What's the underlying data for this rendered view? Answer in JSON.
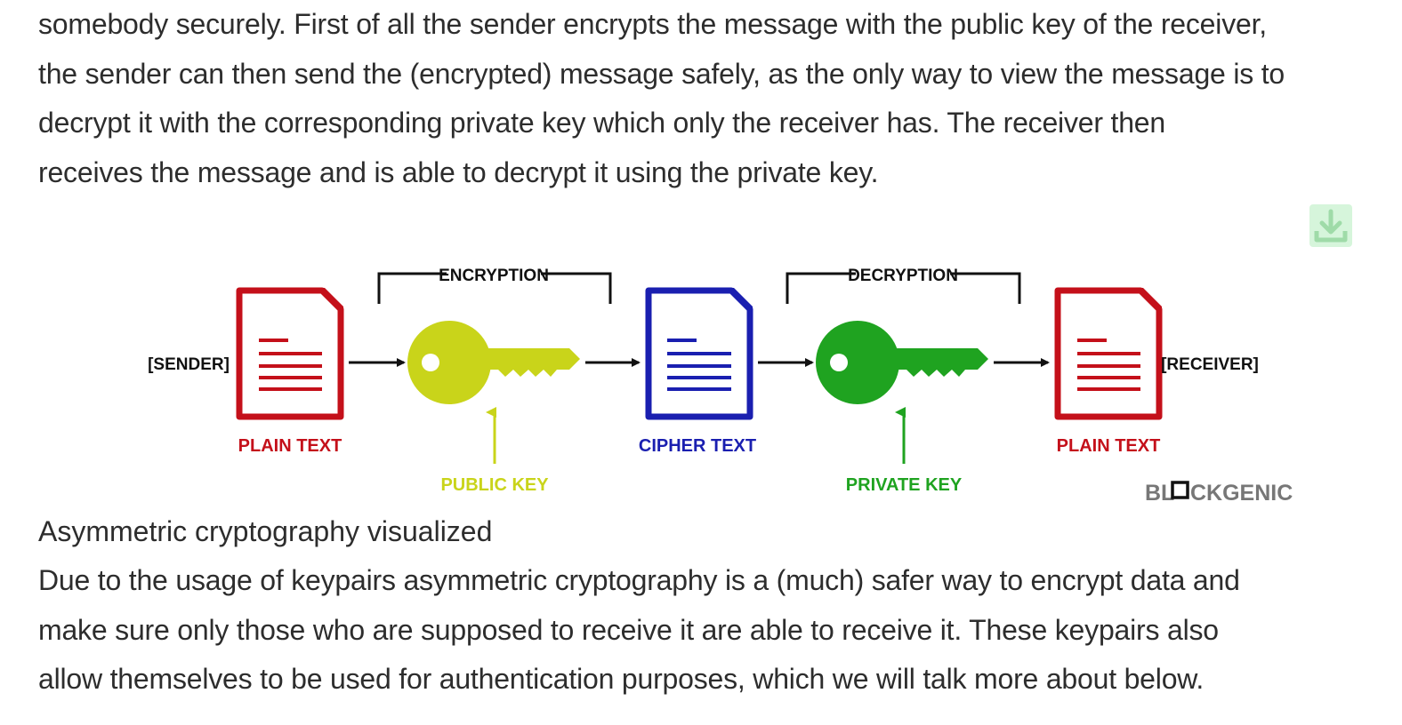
{
  "article": {
    "intro_lines": [
      "somebody securely. First of all the sender encrypts the message with the public key of the receiver,",
      "the sender can then send the (encrypted) message safely, as the only way to view the message is to",
      "decrypt it with the corresponding private key which only the receiver has. The receiver then",
      "receives the message and is able to decrypt it using the private key."
    ],
    "figure_caption": "Asymmetric cryptography visualized",
    "body_lines": [
      "Due to the usage of keypairs asymmetric cryptography is a (much) safer way to encrypt data and",
      "make sure only those who are supposed to receive it are able to receive it. These keypairs also",
      "allow themselves to be used for authentication purposes, which we will talk more about below."
    ]
  },
  "download_button": {
    "icon": "download-icon"
  },
  "diagram": {
    "sender_label": "[SENDER]",
    "receiver_label": "[RECEIVER]",
    "encryption_label": "ENCRYPTION",
    "decryption_label": "DECRYPTION",
    "plain_text_left": "PLAIN TEXT",
    "cipher_text": "CIPHER TEXT",
    "plain_text_right": "PLAIN TEXT",
    "public_key": "PUBLIC KEY",
    "private_key": "PRIVATE KEY",
    "watermark_prefix": "BL",
    "watermark_suffix": "CKGENIC",
    "colors": {
      "plain": "#c4101a",
      "cipher": "#1a1fb0",
      "public_key": "#c9d41a",
      "private_key": "#1fa320",
      "arrow": "#111111",
      "watermark": "#777777"
    }
  }
}
